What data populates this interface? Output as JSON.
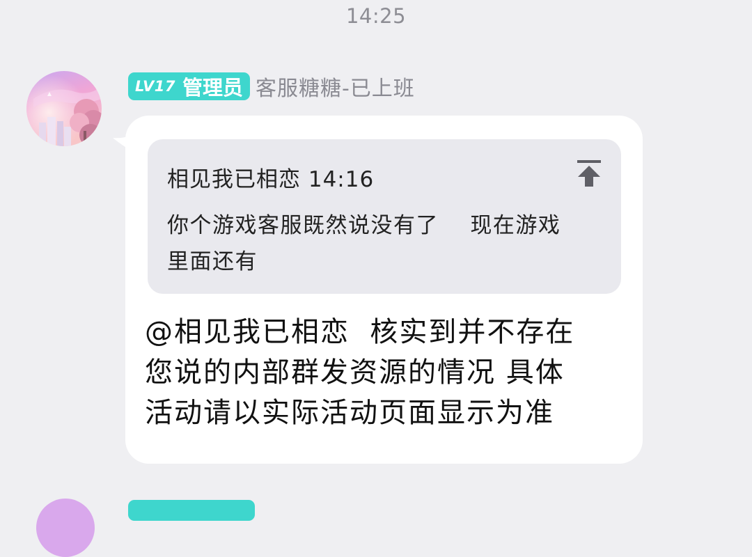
{
  "timestamp": "14:25",
  "message": {
    "badge_level": "LV17",
    "badge_role": "管理员",
    "sender_name": "客服糖糖-已上班",
    "quote": {
      "author_time": "相见我已相恋 14:16",
      "text": "你个游戏客服既然说没有了    现在游戏\n里面还有",
      "jump_icon": "jump-to-original-icon"
    },
    "text": "@相见我已相恋  核实到并不存在\n您说的内部群发资源的情况 具体\n活动请以实际活动页面显示为准"
  },
  "colors": {
    "background": "#efeff2",
    "badge": "#3ed6cd",
    "bubble": "#ffffff",
    "quote_bg": "#e9e9ee",
    "sender_name": "#8a8a92"
  }
}
